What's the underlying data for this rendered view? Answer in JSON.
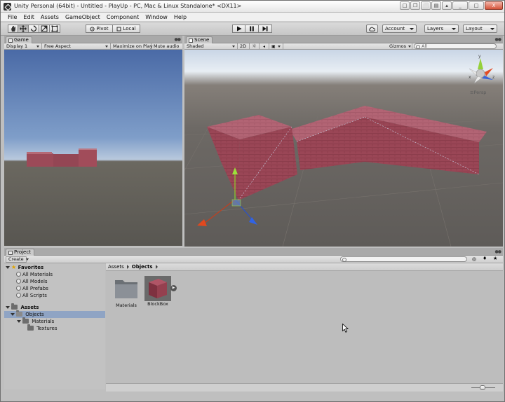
{
  "window": {
    "title": "Unity Personal (64bit) - Untitled - PlayUp - PC, Mac & Linux Standalone* <DX11>",
    "buttons": [
      "□",
      "❐",
      "⬜",
      "▤",
      "▴",
      "_",
      "□",
      "X"
    ]
  },
  "menubar": [
    "File",
    "Edit",
    "Assets",
    "GameObject",
    "Component",
    "Window",
    "Help"
  ],
  "toolbar": {
    "pivot_label": "Pivot",
    "local_label": "Local",
    "account_label": "Account",
    "layers_label": "Layers",
    "layout_label": "Layout"
  },
  "game": {
    "tab": "Game",
    "display": "Display 1",
    "aspect": "Free Aspect",
    "maximize": "Maximize on Play",
    "mute": "Mute audio"
  },
  "scene": {
    "tab": "Scene",
    "shading": "Shaded",
    "mode_2d": "2D",
    "gizmos": "Gizmos",
    "search_placeholder": "All",
    "gizmo_axes": {
      "y": "y",
      "x": "x",
      "z": "z"
    },
    "projection": "Persp"
  },
  "project": {
    "tab": "Project",
    "create": "Create",
    "favorites": {
      "title": "Favorites",
      "items": [
        "All Materials",
        "All Models",
        "All Prefabs",
        "All Scripts"
      ]
    },
    "assets": {
      "title": "Assets",
      "items": [
        {
          "label": "Objects",
          "depth": 1,
          "selected": true
        },
        {
          "label": "Materials",
          "depth": 2,
          "selected": false
        },
        {
          "label": "Textures",
          "depth": 3,
          "selected": false
        }
      ]
    },
    "breadcrumb": [
      "Assets",
      "Objects"
    ],
    "tiles": [
      {
        "label": "Materials",
        "kind": "folder"
      },
      {
        "label": "BlockBox",
        "kind": "prefab"
      }
    ]
  },
  "colors": {
    "brick": "#9c4a58",
    "selection": "#8fa4c4",
    "panel": "#c2c2c2"
  }
}
